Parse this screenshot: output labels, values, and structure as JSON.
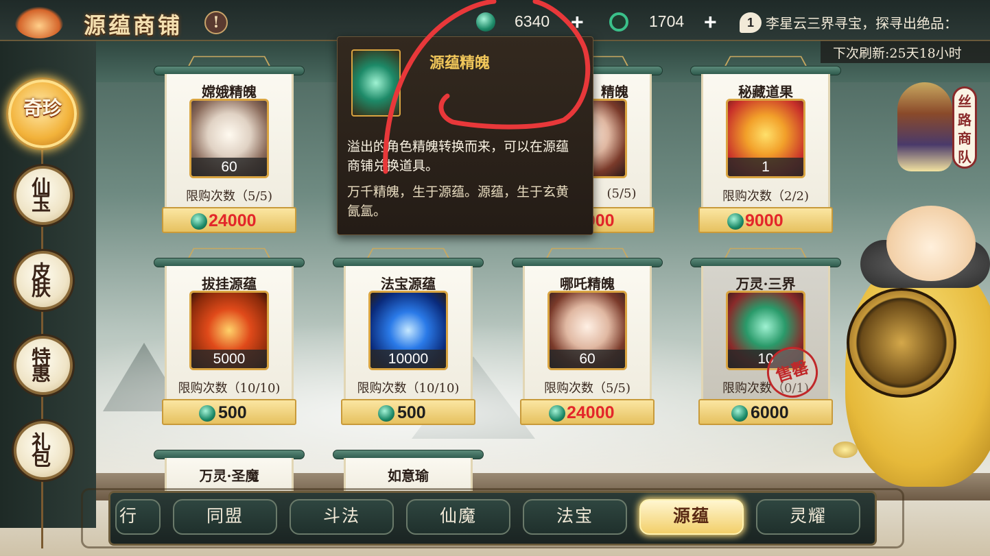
{
  "header": {
    "shop_title": "源蕴商铺",
    "info_symbol": "!",
    "currencies": [
      {
        "icon": "jade-soul-icon",
        "value": "6340",
        "add_symbol": "+",
        "color": "#1d8a68"
      },
      {
        "icon": "spiral-token-icon",
        "value": "1704",
        "add_symbol": "+",
        "color": "#2aa86a"
      }
    ],
    "notice_badge": "1",
    "notice_text": "李星云三界寻宝，探寻出绝品：",
    "refresh_text": "下次刷新:25天18小时"
  },
  "left_nav": [
    {
      "label": "奇珍",
      "active": true
    },
    {
      "label": "仙玉",
      "active": false
    },
    {
      "label": "皮肤",
      "active": false
    },
    {
      "label": "特惠",
      "active": false
    },
    {
      "label": "礼包",
      "active": false
    }
  ],
  "items": [
    {
      "name": "嫦娥精魄",
      "qty": "60",
      "limit": "限购次数（5/5)",
      "price": "24000",
      "price_color": "red",
      "art": "change"
    },
    {
      "name": "精魄",
      "qty": "",
      "limit": "(5/5)",
      "price": "24000",
      "price_color": "red",
      "art": "hidden"
    },
    {
      "name": "秘藏道果",
      "qty": "1",
      "limit": "限购次数（2/2)",
      "price": "9000",
      "price_color": "red",
      "art": "fruit"
    },
    {
      "name": "拔挂源蕴",
      "qty": "5000",
      "limit": "限购次数（10/10)",
      "price": "500",
      "price_color": "dark",
      "art": "fire"
    },
    {
      "name": "法宝源蕴",
      "qty": "10000",
      "limit": "限购次数（10/10)",
      "price": "500",
      "price_color": "dark",
      "art": "blue"
    },
    {
      "name": "哪吒精魄",
      "qty": "60",
      "limit": "限购次数（5/5)",
      "price": "24000",
      "price_color": "red",
      "art": "nezha"
    },
    {
      "name": "万灵·三界",
      "qty": "10",
      "limit": "限购次数（0/1)",
      "price": "6000",
      "price_color": "dark",
      "art": "gem",
      "sold_out": "售罄"
    },
    {
      "name": "万灵·圣魔"
    },
    {
      "name": "如意瑜"
    }
  ],
  "tooltip": {
    "title": "源蕴精魄",
    "description": "溢出的角色精魄转换而来，可以在源蕴商铺兑换道具。",
    "flavor": "万千精魄，生于源蕴。源蕴，生于玄黄氤氲。"
  },
  "merchant": {
    "tag": "丝路商队"
  },
  "bottom_tabs": [
    {
      "label": "行",
      "active": false
    },
    {
      "label": "同盟",
      "active": false
    },
    {
      "label": "斗法",
      "active": false
    },
    {
      "label": "仙魔",
      "active": false
    },
    {
      "label": "法宝",
      "active": false
    },
    {
      "label": "源蕴",
      "active": true
    },
    {
      "label": "灵耀",
      "active": false
    }
  ],
  "colors": {
    "accent_gold": "#f0c65a",
    "price_red": "#e3262a",
    "jade": "#1d8a68",
    "annotation_red": "#e8383a"
  }
}
